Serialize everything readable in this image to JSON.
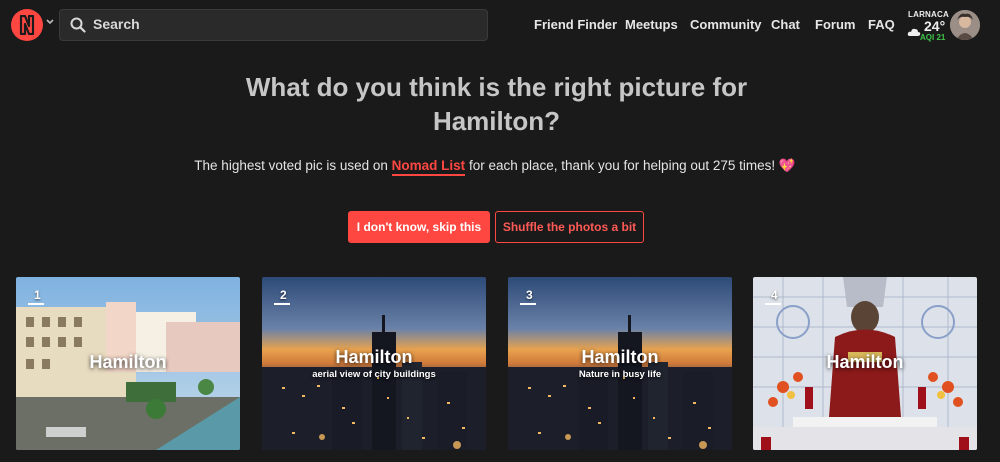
{
  "header": {
    "search_label": "Search",
    "nav": [
      "Friend Finder",
      "Meetups",
      "Community",
      "Chat",
      "Forum",
      "FAQ"
    ],
    "weather": {
      "city": "LARNACA",
      "temp": "24°",
      "aqi": "AQI 21"
    }
  },
  "main": {
    "title": "What do you think is the right picture for Hamilton?",
    "subtitle_pre": "The highest voted pic is used on ",
    "subtitle_brand": "Nomad List",
    "subtitle_post": " for each place, thank you for helping out 275 times! ",
    "heart": "💖",
    "buttons": {
      "skip": "I don't know, skip this",
      "shuffle": "Shuffle the photos a bit"
    }
  },
  "cards": [
    {
      "num": "1",
      "city": "Hamilton",
      "caption": ""
    },
    {
      "num": "2",
      "city": "Hamilton",
      "caption": "aerial view of city buildings"
    },
    {
      "num": "3",
      "city": "Hamilton",
      "caption": "Nature in busy life"
    },
    {
      "num": "4",
      "city": "Hamilton",
      "caption": ""
    }
  ],
  "colors": {
    "accent": "#ff4742",
    "background": "#1a1a1a",
    "aqi_good": "#3ec44a"
  },
  "icons": [
    "nomad-list-logo",
    "chevron-down-icon",
    "search-icon",
    "cloud-icon"
  ]
}
